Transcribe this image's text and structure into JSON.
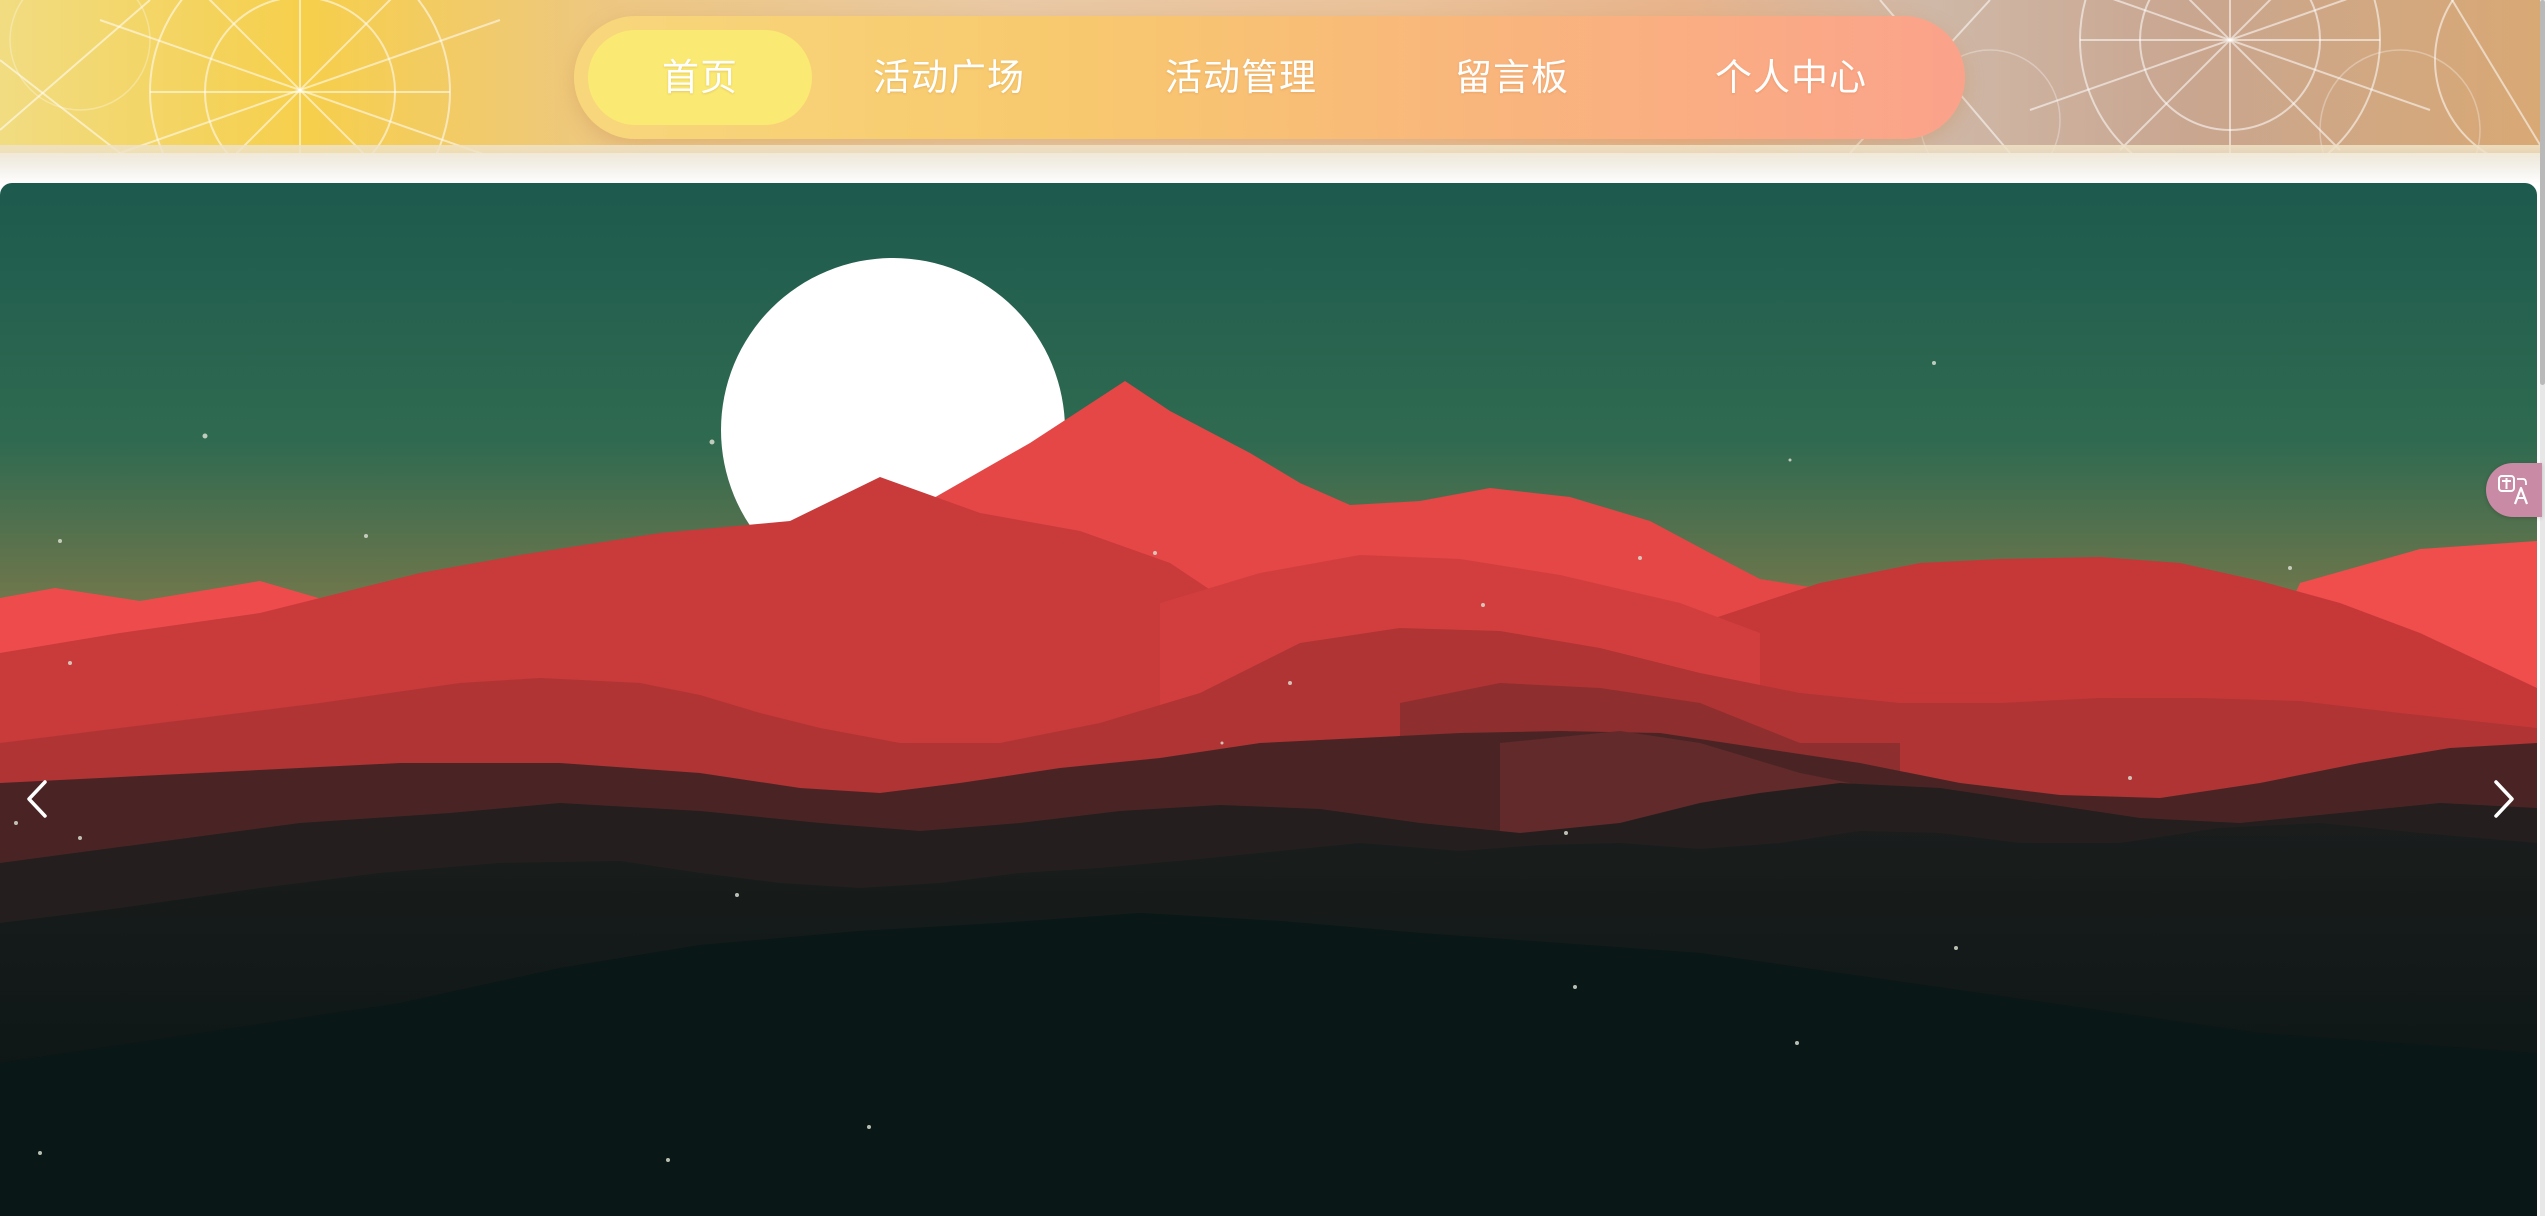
{
  "nav": {
    "items": [
      {
        "label": "首页",
        "active": true
      },
      {
        "label": "活动广场",
        "active": false
      },
      {
        "label": "活动管理",
        "active": false
      },
      {
        "label": "留言板",
        "active": false
      },
      {
        "label": "个人中心",
        "active": false
      }
    ]
  },
  "carousel": {
    "prev_icon": "chevron-left-icon",
    "next_icon": "chevron-right-icon",
    "slide_image": "mountain-sunset-illustration"
  },
  "widgets": {
    "translate_icon": "translate-icon"
  },
  "colors": {
    "nav_active": "#faea73",
    "nav_gradient_start": "#f8d77c",
    "nav_gradient_end": "#fba28b",
    "sky_top": "#1d5a4e",
    "sky_horizon": "#7a7a4c",
    "mountain_red": "#e84444",
    "foreground_dark": "#0b1717",
    "moon": "#ffffff"
  }
}
